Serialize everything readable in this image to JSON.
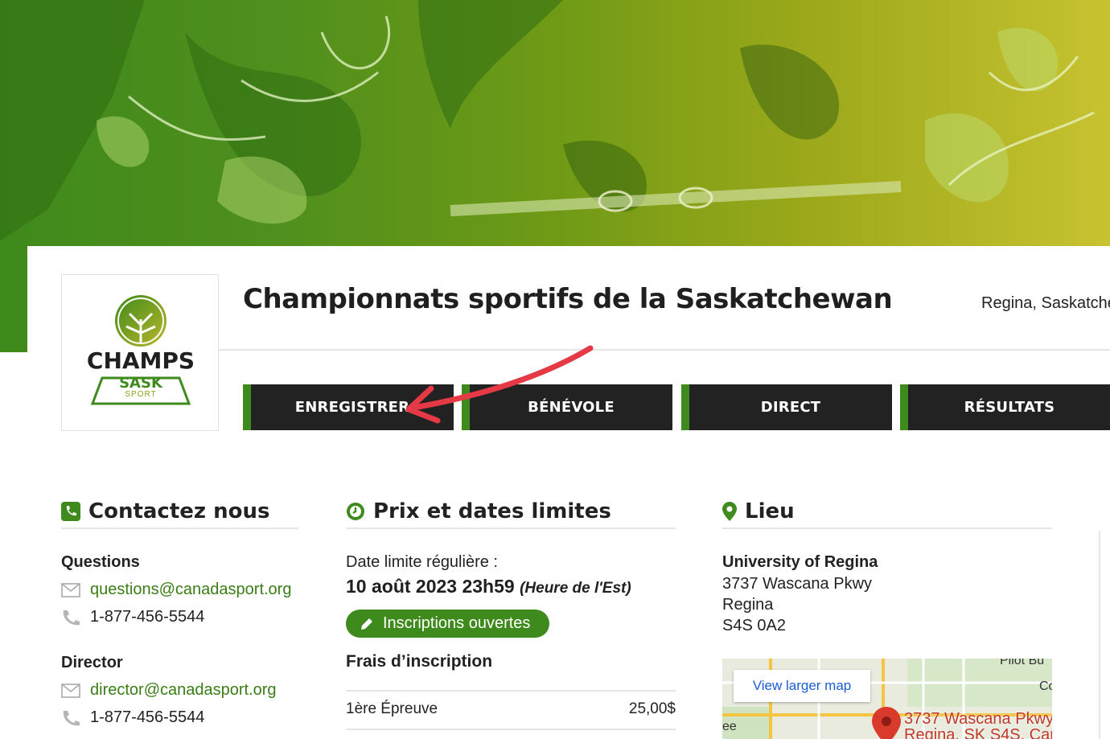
{
  "event": {
    "title": "Championnats sportifs de la Saskatchewan",
    "location": "Regina, Saskatche"
  },
  "logo": {
    "line1": "CHAMPS",
    "line2": "SASK",
    "line3": "SPORT"
  },
  "nav": {
    "register": "ENREGISTRER",
    "volunteer": "BÉNÉVOLE",
    "live": "DIRECT",
    "results": "RÉSULTATS"
  },
  "contact": {
    "heading": "Contactez nous",
    "groups": [
      {
        "label": "Questions",
        "email": "questions@canadasport.org",
        "phone": "1-877-456-5544"
      },
      {
        "label": "Director",
        "email": "director@canadasport.org",
        "phone": "1-877-456-5544"
      }
    ]
  },
  "pricing": {
    "heading": "Prix et dates limites",
    "deadline_label": "Date limite régulière :",
    "deadline_date": "10 août 2023 23h59",
    "deadline_tz": "(Heure de l'Est)",
    "status": "Inscriptions ouvertes",
    "fees_heading": "Frais d’inscription",
    "fees": [
      {
        "name": "1ère Épreuve",
        "price": "25,00$"
      }
    ]
  },
  "venue": {
    "heading": "Lieu",
    "name": "University of Regina",
    "street": "3737 Wascana Pkwy",
    "city": "Regina",
    "postal": "S4S 0A2",
    "map_button": "View larger map",
    "map_pin_line1": "3737 Wascana Pkwy",
    "map_pin_line2": "Regina, SK S4S, Can",
    "map_fragment_top": "Pilot Bu",
    "map_fragment_right": "Co",
    "map_fragment_left": "ee"
  },
  "colors": {
    "brand_green": "#3f8a1c",
    "nav_dark": "#222222",
    "link_green": "#3a7d16",
    "arrow_red": "#e63946"
  },
  "icons": [
    "phone-square-icon",
    "clock-icon",
    "map-marker-icon",
    "envelope-icon",
    "phone-icon",
    "pencil-icon",
    "tree-logo-icon",
    "map-pin-icon"
  ]
}
